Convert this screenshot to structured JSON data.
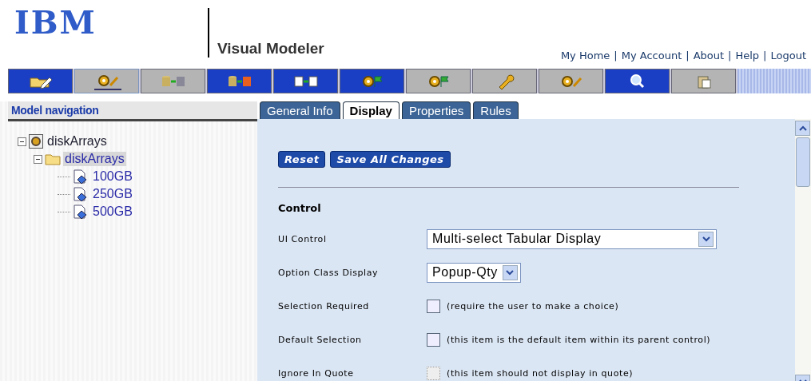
{
  "header": {
    "logo": "IBM",
    "title": "Visual Modeler",
    "separator": "|",
    "links": [
      "My Home",
      "My Account",
      "About",
      "Help",
      "Logout"
    ]
  },
  "toolbar": [
    {
      "color": "#1a3fc4",
      "selected": false
    },
    {
      "color": "#b4b4b4",
      "selected": true
    },
    {
      "color": "#b4b4b4",
      "selected": false
    },
    {
      "color": "#1a3fc4",
      "selected": false
    },
    {
      "color": "#1a3fc4",
      "selected": false
    },
    {
      "color": "#1a3fc4",
      "selected": false
    },
    {
      "color": "#b4b4b4",
      "selected": false
    },
    {
      "color": "#b4b4b4",
      "selected": false
    },
    {
      "color": "#b4b4b4",
      "selected": false
    },
    {
      "color": "#1a3fc4",
      "selected": false
    },
    {
      "color": "#b4b4b4",
      "selected": false
    }
  ],
  "sidebar": {
    "title": "Model navigation",
    "tree": [
      {
        "label": "diskArrays",
        "kind": "model",
        "expanded": true,
        "selected": false,
        "children": [
          {
            "label": "diskArrays",
            "kind": "folder",
            "expanded": true,
            "selected": true,
            "children": [
              {
                "label": "100GB",
                "kind": "item",
                "selected": false
              },
              {
                "label": "250GB",
                "kind": "item",
                "selected": false
              },
              {
                "label": "500GB",
                "kind": "item",
                "selected": false
              }
            ]
          }
        ]
      }
    ]
  },
  "tabs": [
    {
      "label": "General Info",
      "selected": false
    },
    {
      "label": "Display",
      "selected": true
    },
    {
      "label": "Properties",
      "selected": false
    },
    {
      "label": "Rules",
      "selected": false
    }
  ],
  "buttons": [
    "Reset",
    "Save All Changes"
  ],
  "section": "Control",
  "fields": [
    {
      "label": "UI Control",
      "kind": "select",
      "value": "Multi-select Tabular Display"
    },
    {
      "label": "Option Class Display",
      "kind": "select",
      "value": "Popup-Qty"
    },
    {
      "label": "Selection Required",
      "kind": "checkbox",
      "checked": false,
      "disabled": false,
      "note": "(require the user to make a choice)"
    },
    {
      "label": "Default Selection",
      "kind": "checkbox",
      "checked": false,
      "disabled": false,
      "note": "(this item is the default item within its parent control)"
    },
    {
      "label": "Ignore In Quote",
      "kind": "checkbox",
      "checked": false,
      "disabled": true,
      "note": "(this item should not display in quote)"
    }
  ]
}
